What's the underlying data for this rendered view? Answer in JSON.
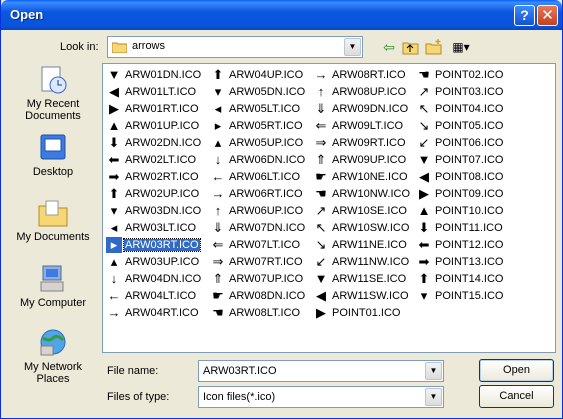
{
  "window": {
    "title": "Open",
    "help_glyph": "?",
    "close_glyph": "✕"
  },
  "lookin": {
    "label": "Look in:",
    "value": "arrows"
  },
  "places": [
    {
      "label": "My Recent Documents",
      "icon": "recent-documents-icon"
    },
    {
      "label": "Desktop",
      "icon": "desktop-icon"
    },
    {
      "label": "My Documents",
      "icon": "my-documents-icon"
    },
    {
      "label": "My Computer",
      "icon": "my-computer-icon"
    },
    {
      "label": "My Network Places",
      "icon": "network-places-icon"
    }
  ],
  "files": [
    [
      "ARW01DN.ICO",
      "ARW01LT.ICO",
      "ARW01RT.ICO",
      "ARW01UP.ICO",
      "ARW02DN.ICO",
      "ARW02LT.ICO",
      "ARW02RT.ICO",
      "ARW02UP.ICO",
      "ARW03DN.ICO",
      "ARW03LT.ICO",
      "ARW03RT.ICO",
      "ARW03UP.ICO",
      "ARW04DN.ICO",
      "ARW04LT.ICO",
      "ARW04RT.ICO"
    ],
    [
      "ARW04UP.ICO",
      "ARW05DN.ICO",
      "ARW05LT.ICO",
      "ARW05RT.ICO",
      "ARW05UP.ICO",
      "ARW06DN.ICO",
      "ARW06LT.ICO",
      "ARW06RT.ICO",
      "ARW06UP.ICO",
      "ARW07DN.ICO",
      "ARW07LT.ICO",
      "ARW07RT.ICO",
      "ARW07UP.ICO",
      "ARW08DN.ICO",
      "ARW08LT.ICO"
    ],
    [
      "ARW08RT.ICO",
      "ARW08UP.ICO",
      "ARW09DN.ICO",
      "ARW09LT.ICO",
      "ARW09RT.ICO",
      "ARW09UP.ICO",
      "ARW10NE.ICO",
      "ARW10NW.ICO",
      "ARW10SE.ICO",
      "ARW10SW.ICO",
      "ARW11NE.ICO",
      "ARW11NW.ICO",
      "ARW11SE.ICO",
      "ARW11SW.ICO",
      "POINT01.ICO"
    ],
    [
      "POINT02.ICO",
      "POINT03.ICO",
      "POINT04.ICO",
      "POINT05.ICO",
      "POINT06.ICO",
      "POINT07.ICO",
      "POINT08.ICO",
      "POINT09.ICO",
      "POINT10.ICO",
      "POINT11.ICO",
      "POINT12.ICO",
      "POINT13.ICO",
      "POINT14.ICO",
      "POINT15.ICO"
    ]
  ],
  "selected_file": "ARW03RT.ICO",
  "filename": {
    "label": "File name:",
    "value": "ARW03RT.ICO"
  },
  "filetype": {
    "label": "Files of type:",
    "value": "Icon files(*.ico)"
  },
  "buttons": {
    "open": "Open",
    "cancel": "Cancel"
  }
}
